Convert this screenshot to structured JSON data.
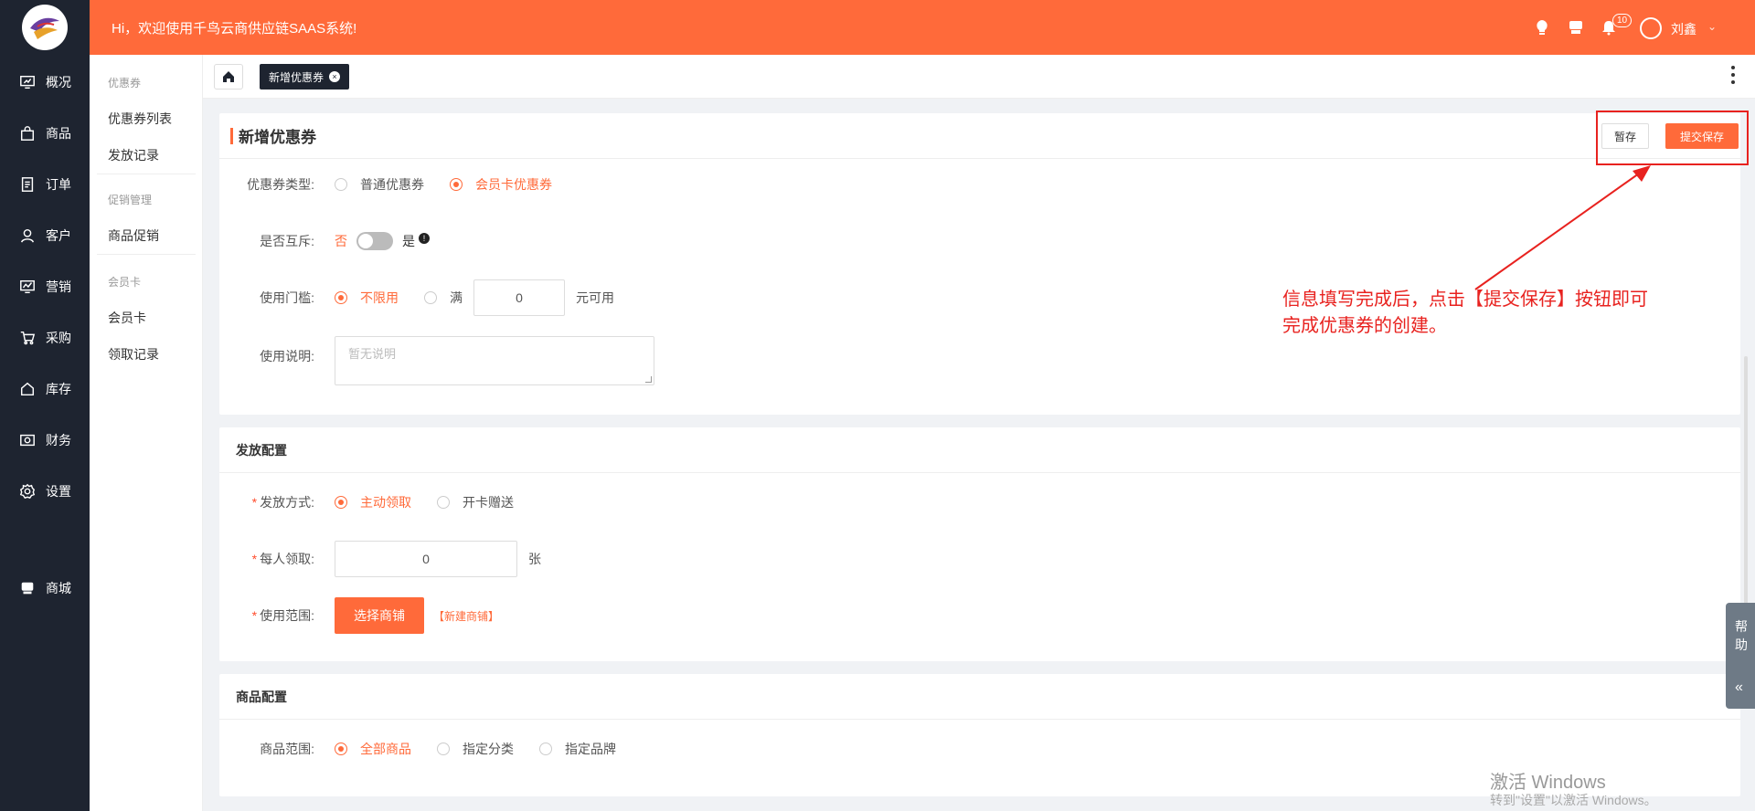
{
  "header": {
    "welcome": "Hi，欢迎使用千鸟云商供应链SAAS系统!",
    "notification_count": "10",
    "user_name": "刘鑫",
    "brand_color": "#ff6a3a"
  },
  "nav": {
    "items": [
      {
        "label": "概况",
        "icon": "dashboard-icon"
      },
      {
        "label": "商品",
        "icon": "bag-icon"
      },
      {
        "label": "订单",
        "icon": "order-icon"
      },
      {
        "label": "客户",
        "icon": "user-icon"
      },
      {
        "label": "营销",
        "icon": "chart-icon"
      },
      {
        "label": "采购",
        "icon": "cart-icon"
      },
      {
        "label": "库存",
        "icon": "house-icon"
      },
      {
        "label": "财务",
        "icon": "wallet-icon"
      },
      {
        "label": "设置",
        "icon": "gear-icon"
      },
      {
        "label": "商城",
        "icon": "store-icon"
      }
    ]
  },
  "submenu": {
    "group1": "优惠券",
    "item1": "优惠券列表",
    "item2": "发放记录",
    "group2": "促销管理",
    "item3": "商品促销",
    "group3": "会员卡",
    "item4": "会员卡",
    "item5": "领取记录"
  },
  "breadcrumb": {
    "tab": "新增优惠券"
  },
  "form": {
    "title": "新增优惠券",
    "draft_button": "暂存",
    "submit_button": "提交保存",
    "coupon_type_label": "优惠券类型:",
    "coupon_type_opt1": "普通优惠券",
    "coupon_type_opt2": "会员卡优惠券",
    "exclusive_label": "是否互斥:",
    "exclusive_no": "否",
    "exclusive_yes": "是",
    "threshold_label": "使用门槛:",
    "threshold_opt1": "不限用",
    "threshold_opt2": "满",
    "threshold_value": "0",
    "threshold_suffix": "元可用",
    "desc_label": "使用说明:",
    "desc_placeholder": "暂无说明"
  },
  "issue": {
    "title": "发放配置",
    "method_label": "发放方式:",
    "method_opt1": "主动领取",
    "method_opt2": "开卡赠送",
    "per_person_label": "每人领取:",
    "per_person_value": "0",
    "per_person_unit": "张",
    "scope_label": "使用范围:",
    "scope_button": "选择商铺",
    "scope_link": "【新建商铺】"
  },
  "goods": {
    "title": "商品配置",
    "range_label": "商品范围:",
    "range_opt1": "全部商品",
    "range_opt2": "指定分类",
    "range_opt3": "指定品牌"
  },
  "annotation": {
    "line1": "信息填写完成后，点击【提交保存】按钮即可",
    "line2": "完成优惠券的创建。",
    "color": "#e8221f"
  },
  "help": {
    "label1": "帮",
    "label2": "助",
    "collapse": "«"
  },
  "watermark": {
    "line1": "激活 Windows",
    "line2": "转到\"设置\"以激活 Windows。"
  }
}
